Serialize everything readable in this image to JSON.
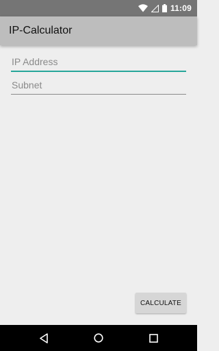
{
  "status_bar": {
    "time": "11:09",
    "icons": [
      "wifi-icon",
      "signal-icon",
      "battery-icon"
    ]
  },
  "app_bar": {
    "title": "IP-Calculator",
    "color": "#bdbdbd"
  },
  "form": {
    "ip_address": {
      "placeholder": "IP Address",
      "value": ""
    },
    "subnet": {
      "placeholder": "Subnet",
      "value": ""
    },
    "accent_color": "#26a69a"
  },
  "actions": {
    "calculate_label": "CALCULATE"
  },
  "nav_bar": {
    "icons": [
      "back-icon",
      "home-icon",
      "recents-icon"
    ]
  }
}
